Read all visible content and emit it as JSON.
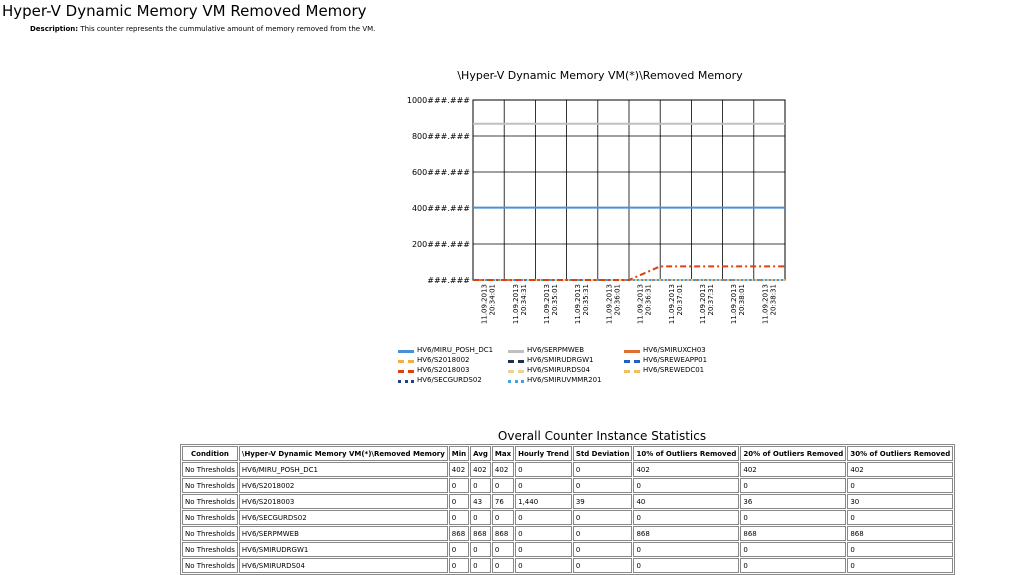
{
  "page": {
    "title": "Hyper-V Dynamic Memory VM Removed Memory",
    "description_label": "Description:",
    "description_text": "This counter represents the cummulative amount of memory removed from the VM."
  },
  "chart_data": {
    "type": "line",
    "title": "\\Hyper-V Dynamic Memory VM(*)\\Removed Memory",
    "ylim": [
      0,
      1000
    ],
    "y_tick_labels": [
      "###.###",
      "200###.###",
      "400###.###",
      "600###.###",
      "800###.###",
      "1000###.###"
    ],
    "y_ticks": [
      0,
      200,
      400,
      600,
      800,
      1000
    ],
    "x": [
      "11.09.2013 20:34:01",
      "11.09.2013 20:34:31",
      "11.09.2013 20:35:01",
      "11.09.2013 20:35:31",
      "11.09.2013 20:36:01",
      "11.09.2013 20:36:31",
      "11.09.2013 20:37:01",
      "11.09.2013 20:37:31",
      "11.09.2013 20:38:01",
      "11.09.2013 20:38:31"
    ],
    "x_tick_lines": [
      [
        "11.09.2013",
        "20:34:01"
      ],
      [
        "11.09.2013",
        "20:34:31"
      ],
      [
        "11.09.2013",
        "20:35:01"
      ],
      [
        "11.09.2013",
        "20:35:31"
      ],
      [
        "11.09.2013",
        "20:36:01"
      ],
      [
        "11.09.2013",
        "20:36:31"
      ],
      [
        "11.09.2013",
        "20:37:01"
      ],
      [
        "11.09.2013",
        "20:37:31"
      ],
      [
        "11.09.2013",
        "20:38:01"
      ],
      [
        "11.09.2013",
        "20:38:31"
      ]
    ],
    "grid": true,
    "legend_position": "bottom",
    "series": [
      {
        "name": "HV6/MIRU_POSH_DC1",
        "color": "#4a90d9",
        "dash": "solid",
        "values": [
          402,
          402,
          402,
          402,
          402,
          402,
          402,
          402,
          402,
          402,
          402
        ]
      },
      {
        "name": "HV6/SERPMWEB",
        "color": "#c0c0c0",
        "dash": "solid",
        "values": [
          868,
          868,
          868,
          868,
          868,
          868,
          868,
          868,
          868,
          868,
          868
        ]
      },
      {
        "name": "HV6/SMIRUXCH03",
        "color": "#e07030",
        "dash": "solid",
        "values": [
          0,
          0,
          0,
          0,
          0,
          0,
          0,
          0,
          0,
          0,
          0
        ]
      },
      {
        "name": "HV6/S2018002",
        "color": "#f0b040",
        "dash": "dash",
        "values": [
          0,
          0,
          0,
          0,
          0,
          0,
          0,
          0,
          0,
          0,
          0
        ]
      },
      {
        "name": "HV6/SMIRUDRGW1",
        "color": "#203050",
        "dash": "dash",
        "values": [
          0,
          0,
          0,
          0,
          0,
          0,
          0,
          0,
          0,
          0,
          0
        ]
      },
      {
        "name": "HV6/SREWEAPP01",
        "color": "#2060c0",
        "dash": "dash",
        "values": [
          0,
          0,
          0,
          0,
          0,
          0,
          0,
          0,
          0,
          0,
          0
        ]
      },
      {
        "name": "HV6/S2018003",
        "color": "#e04010",
        "dash": "dashdot",
        "values": [
          0,
          0,
          0,
          0,
          0,
          0,
          76,
          76,
          76,
          76,
          76
        ]
      },
      {
        "name": "HV6/SMIRURDS04",
        "color": "#f0d090",
        "dash": "dash",
        "values": [
          0,
          0,
          0,
          0,
          0,
          0,
          0,
          0,
          0,
          0,
          0
        ]
      },
      {
        "name": "HV6/SREWEDC01",
        "color": "#f0c060",
        "dash": "dashdot",
        "values": [
          0,
          0,
          0,
          0,
          0,
          0,
          0,
          0,
          0,
          0,
          0
        ]
      },
      {
        "name": "HV6/SECGURDS02",
        "color": "#204080",
        "dash": "dot",
        "values": [
          0,
          0,
          0,
          0,
          0,
          0,
          0,
          0,
          0,
          0,
          0
        ]
      },
      {
        "name": "HV6/SMIRUVMMR201",
        "color": "#40a0e0",
        "dash": "dot",
        "values": [
          0,
          0,
          0,
          0,
          0,
          0,
          0,
          0,
          0,
          0,
          0
        ]
      }
    ]
  },
  "stats": {
    "title": "Overall Counter Instance Statistics",
    "headers": [
      "Condition",
      "\\Hyper-V Dynamic Memory VM(*)\\Removed Memory",
      "Min",
      "Avg",
      "Max",
      "Hourly Trend",
      "Std Deviation",
      "10% of Outliers Removed",
      "20% of Outliers Removed",
      "30% of Outliers Removed"
    ],
    "rows": [
      [
        "No Thresholds",
        "HV6/MIRU_POSH_DC1",
        "402",
        "402",
        "402",
        "0",
        "0",
        "402",
        "402",
        "402"
      ],
      [
        "No Thresholds",
        "HV6/S2018002",
        "0",
        "0",
        "0",
        "0",
        "0",
        "0",
        "0",
        "0"
      ],
      [
        "No Thresholds",
        "HV6/S2018003",
        "0",
        "43",
        "76",
        "1,440",
        "39",
        "40",
        "36",
        "30"
      ],
      [
        "No Thresholds",
        "HV6/SECGURDS02",
        "0",
        "0",
        "0",
        "0",
        "0",
        "0",
        "0",
        "0"
      ],
      [
        "No Thresholds",
        "HV6/SERPMWEB",
        "868",
        "868",
        "868",
        "0",
        "0",
        "868",
        "868",
        "868"
      ],
      [
        "No Thresholds",
        "HV6/SMIRUDRGW1",
        "0",
        "0",
        "0",
        "0",
        "0",
        "0",
        "0",
        "0"
      ],
      [
        "No Thresholds",
        "HV6/SMIRURDS04",
        "0",
        "0",
        "0",
        "0",
        "0",
        "0",
        "0",
        "0"
      ]
    ]
  }
}
